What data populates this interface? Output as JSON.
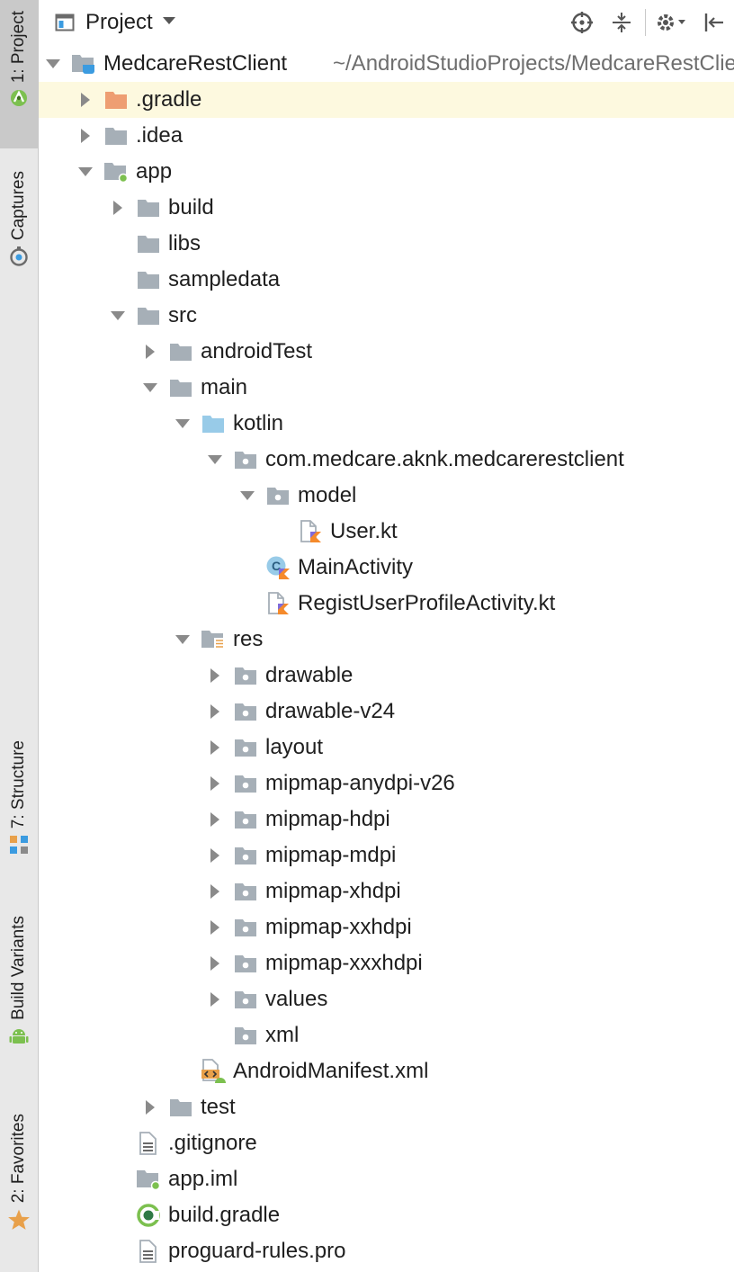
{
  "toolstrip": {
    "project_tab": "1: Project",
    "captures_tab": "Captures",
    "structure_tab": "7: Structure",
    "build_variants_tab": "Build Variants",
    "favorites_tab": "2: Favorites"
  },
  "header": {
    "title": "Project",
    "icons": [
      "project-icon",
      "dropdown-arrow-icon",
      "locate-icon",
      "collapse-all-icon",
      "settings-icon",
      "hide-panel-icon"
    ]
  },
  "colors": {
    "selection": "#fdf9df",
    "folder": "#a6afb7",
    "gradle_folder": "#ee9e72",
    "source_folder": "#98cbe8",
    "android_green": "#7cc04f",
    "kotlin_orange": "#f58a2b"
  },
  "tree": [
    {
      "label": "MedcareRestClient",
      "path": "~/AndroidStudioProjects/MedcareRestClient",
      "icon": "project-module-icon"
    },
    {
      "label": ".gradle",
      "icon": "folder-orange-icon"
    },
    {
      "label": ".idea",
      "icon": "folder-icon"
    },
    {
      "label": "app",
      "icon": "module-folder-icon"
    },
    {
      "label": "build",
      "icon": "folder-icon"
    },
    {
      "label": "libs",
      "icon": "folder-icon"
    },
    {
      "label": "sampledata",
      "icon": "folder-icon"
    },
    {
      "label": "src",
      "icon": "folder-icon"
    },
    {
      "label": "androidTest",
      "icon": "folder-icon"
    },
    {
      "label": "main",
      "icon": "folder-icon"
    },
    {
      "label": "kotlin",
      "icon": "source-folder-icon"
    },
    {
      "label": "com.medcare.aknk.medcarerestclient",
      "icon": "package-icon"
    },
    {
      "label": "model",
      "icon": "package-icon"
    },
    {
      "label": "User.kt",
      "icon": "kotlin-file-icon"
    },
    {
      "label": "MainActivity",
      "icon": "kotlin-class-icon"
    },
    {
      "label": "RegistUserProfileActivity.kt",
      "icon": "kotlin-file-icon"
    },
    {
      "label": "res",
      "icon": "resource-folder-icon"
    },
    {
      "label": "drawable",
      "icon": "package-icon"
    },
    {
      "label": "drawable-v24",
      "icon": "package-icon"
    },
    {
      "label": "layout",
      "icon": "package-icon"
    },
    {
      "label": "mipmap-anydpi-v26",
      "icon": "package-icon"
    },
    {
      "label": "mipmap-hdpi",
      "icon": "package-icon"
    },
    {
      "label": "mipmap-mdpi",
      "icon": "package-icon"
    },
    {
      "label": "mipmap-xhdpi",
      "icon": "package-icon"
    },
    {
      "label": "mipmap-xxhdpi",
      "icon": "package-icon"
    },
    {
      "label": "mipmap-xxxhdpi",
      "icon": "package-icon"
    },
    {
      "label": "values",
      "icon": "package-icon"
    },
    {
      "label": "xml",
      "icon": "package-icon"
    },
    {
      "label": "AndroidManifest.xml",
      "icon": "manifest-file-icon"
    },
    {
      "label": "test",
      "icon": "folder-icon"
    },
    {
      "label": ".gitignore",
      "icon": "text-file-icon"
    },
    {
      "label": "app.iml",
      "icon": "iml-file-icon"
    },
    {
      "label": "build.gradle",
      "icon": "gradle-file-icon"
    },
    {
      "label": "proguard-rules.pro",
      "icon": "text-file-icon"
    }
  ]
}
